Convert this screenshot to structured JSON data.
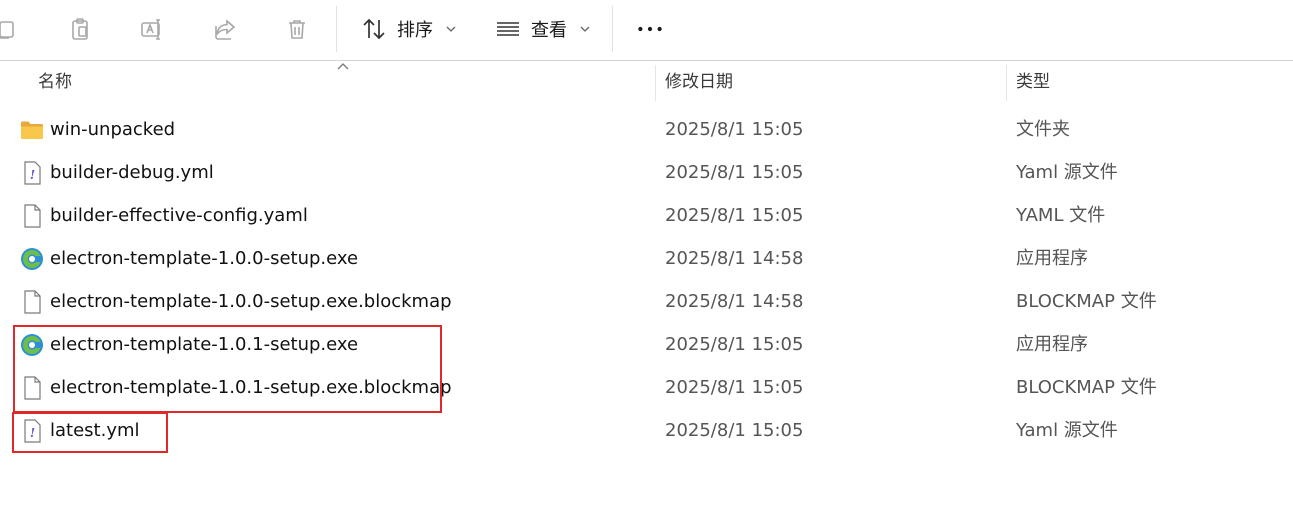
{
  "toolbar": {
    "sort_label": "排序",
    "view_label": "查看",
    "more_label": "•••"
  },
  "columns": {
    "name": "名称",
    "date": "修改日期",
    "type": "类型"
  },
  "files": [
    {
      "icon": "folder-icon",
      "name": "win-unpacked",
      "date": "2025/8/1 15:05",
      "type": "文件夹"
    },
    {
      "icon": "yaml-file-icon",
      "name": "builder-debug.yml",
      "date": "2025/8/1 15:05",
      "type": "Yaml 源文件"
    },
    {
      "icon": "generic-file-icon",
      "name": "builder-effective-config.yaml",
      "date": "2025/8/1 15:05",
      "type": "YAML 文件"
    },
    {
      "icon": "electron-app-icon",
      "name": "electron-template-1.0.0-setup.exe",
      "date": "2025/8/1 14:58",
      "type": "应用程序"
    },
    {
      "icon": "generic-file-icon",
      "name": "electron-template-1.0.0-setup.exe.blockmap",
      "date": "2025/8/1 14:58",
      "type": "BLOCKMAP 文件"
    },
    {
      "icon": "electron-app-icon",
      "name": "electron-template-1.0.1-setup.exe",
      "date": "2025/8/1 15:05",
      "type": "应用程序"
    },
    {
      "icon": "generic-file-icon",
      "name": "electron-template-1.0.1-setup.exe.blockmap",
      "date": "2025/8/1 15:05",
      "type": "BLOCKMAP 文件"
    },
    {
      "icon": "yaml-file-icon",
      "name": "latest.yml",
      "date": "2025/8/1 15:05",
      "type": "Yaml 源文件"
    }
  ],
  "colors": {
    "highlight": "#e02a2a",
    "folder": "#f6c343",
    "toolbar_icon_disabled": "#a8a8a8"
  }
}
